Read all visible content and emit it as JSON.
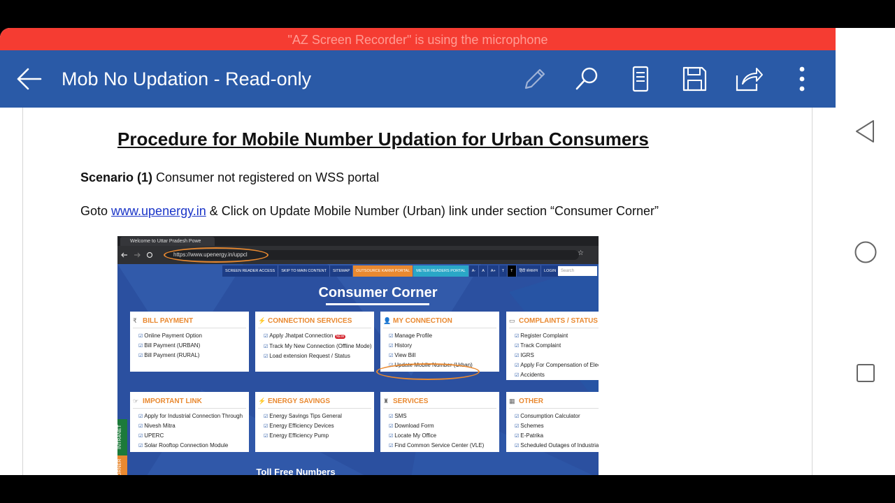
{
  "recorder_banner": "\"AZ Screen Recorder\" is using the microphone",
  "appbar": {
    "title": "Mob No Updation - Read-only",
    "icons": [
      "back-arrow-icon",
      "pencil-icon",
      "search-icon",
      "reading-view-icon",
      "save-icon",
      "share-icon",
      "more-vert-icon"
    ]
  },
  "document": {
    "heading": "Procedure  for Mobile Number Updation for Urban Consumers",
    "scenario_label": "Scenario (1)",
    "scenario_text": " Consumer not registered on WSS portal",
    "goto_prefix": "Goto ",
    "goto_link": "www.upenergy.in",
    "goto_suffix": " & Click on Update Mobile Number (Urban) link under section “Consumer Corner”"
  },
  "screenshot": {
    "tab_title": "Welcome to Uttar Pradesh Powe",
    "url": "https://www.upenergy.in/uppcl",
    "nav_items": [
      "SCREEN READER ACCESS",
      "SKIP TO MAIN CONTENT",
      "SITEMAP",
      "OUTSOURCE KARMI PORTAL",
      "METER READERS PORTAL",
      "A-",
      "A",
      "A+",
      "T",
      "T",
      "हिंदी संस्करण",
      "LOGIN"
    ],
    "search_placeholder": "Search",
    "section_title": "Consumer Corner",
    "cards": [
      {
        "title": "BILL PAYMENT",
        "items": [
          "Online Payment Option",
          "Bill Payment (URBAN)",
          "Bill Payment (RURAL)"
        ]
      },
      {
        "title": "CONNECTION SERVICES",
        "items": [
          "Apply Jhatpat Connection",
          "Track My New Connection (Offline Mode)",
          "Load extension Request / Status"
        ]
      },
      {
        "title": "MY CONNECTION",
        "items": [
          "Manage Profile",
          "History",
          "View Bill",
          "Update Mobile Number (Urban)"
        ]
      },
      {
        "title": "COMPLAINTS / STATUS",
        "items": [
          "Register Complaint",
          "Track Complaint",
          "IGRS",
          "Apply For Compensation of Electric",
          "Accidents"
        ]
      },
      {
        "title": "IMPORTANT LINK",
        "items": [
          "Apply for Industrial Connection Through",
          "Nivesh Mitra",
          "UPERC",
          "Solar Rooftop Connection Module"
        ]
      },
      {
        "title": "ENERGY SAVINGS",
        "items": [
          "Energy Savings Tips General",
          "Energy Efficiency Devices",
          "Energy Efficiency Pump"
        ]
      },
      {
        "title": "SERVICES",
        "items": [
          "SMS",
          "Download Form",
          "Locate My Office",
          "Find Common Service Center (VLE)"
        ]
      },
      {
        "title": "OTHER",
        "items": [
          "Consumption Calculator",
          "Schemes",
          "E-Patrika",
          "Scheduled Outages of Industrial"
        ]
      }
    ],
    "side_tab_intranet": "INTRANET",
    "side_tab_corner": "CORNER",
    "toll_free": "Toll Free Numbers",
    "new_badge": "NEW"
  },
  "colors": {
    "appbar": "#2a5aa7",
    "recorder": "#f53c32",
    "accent_orange": "#e98930",
    "site_blue": "#2b50a0"
  }
}
